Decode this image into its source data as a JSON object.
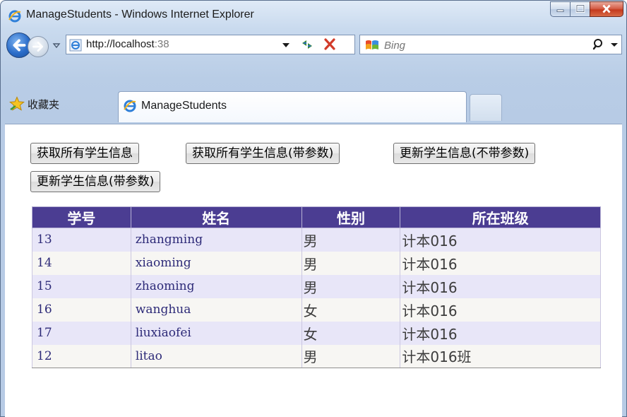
{
  "window": {
    "title": "ManageStudents - Windows Internet Explorer"
  },
  "address_bar": {
    "url_host": "http://localhost",
    "url_port": ":38"
  },
  "search": {
    "placeholder": "Bing"
  },
  "favorites": {
    "label": "收藏夹"
  },
  "tab": {
    "label": "ManageStudents"
  },
  "buttons": [
    {
      "label": "获取所有学生信息"
    },
    {
      "label": "获取所有学生信息(带参数)"
    },
    {
      "label": "更新学生信息(不带参数)"
    },
    {
      "label": "更新学生信息(带参数)"
    }
  ],
  "table": {
    "headers": [
      "学号",
      "姓名",
      "性别",
      "所在班级"
    ],
    "rows": [
      {
        "id": "13",
        "name": "zhangming",
        "gender": "男",
        "class": "计本016"
      },
      {
        "id": "14",
        "name": "xiaoming",
        "gender": "男",
        "class": "计本016"
      },
      {
        "id": "15",
        "name": "zhaoming",
        "gender": "男",
        "class": "计本016"
      },
      {
        "id": "16",
        "name": "wanghua",
        "gender": "女",
        "class": "计本016"
      },
      {
        "id": "17",
        "name": "liuxiaofei",
        "gender": "女",
        "class": "计本016"
      },
      {
        "id": "12",
        "name": "litao",
        "gender": "男",
        "class": "计本016班"
      }
    ]
  },
  "colors": {
    "header_bg": "#4b3d92",
    "row_odd": "#e8e6f8",
    "row_even": "#f7f6f3",
    "cell_text": "#2d2a78"
  },
  "icons": {
    "title": "ie-logo-icon",
    "back": "back-arrow-icon",
    "forward": "forward-arrow-icon",
    "refresh": "refresh-icon",
    "stop": "stop-icon",
    "search": "search-icon",
    "favorites": "favorites-star-icon"
  }
}
